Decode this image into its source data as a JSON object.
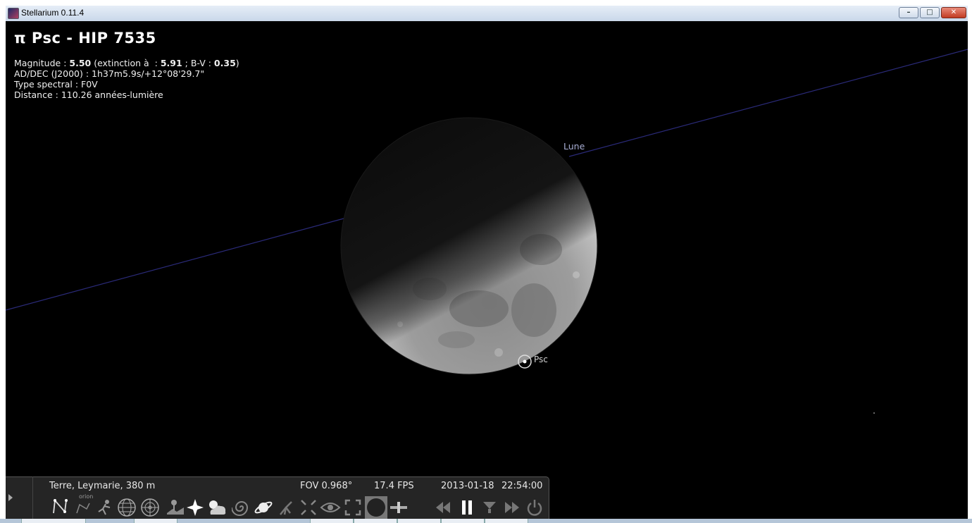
{
  "window": {
    "title": "Stellarium 0.11.4",
    "controls": {
      "minimize": "–",
      "maximize": "□",
      "close": "✕"
    }
  },
  "info": {
    "title": "π Psc - HIP 7535",
    "magnitude_label": "Magnitude : ",
    "magnitude_value": "5.50",
    "extinction_label": " (extinction à  : ",
    "extinction_value": "5.91",
    "bv_label": " ; B-V : ",
    "bv_value": "0.35",
    "bv_close": ")",
    "radec": "AD/DEC (J2000) : 1h37m5.9s/+12°08'29.7\"",
    "spectral": "Type spectral : F0V",
    "distance": "Distance : 110.26 années-lumière"
  },
  "sky": {
    "labels": {
      "moon": "Lune",
      "star": "Psc"
    },
    "colors": {
      "ecliptic": "#2a2a78",
      "moon_lit": "#a8a8a8",
      "moon_dark": "#161616"
    }
  },
  "status": {
    "location": "Terre, Leymarie, 380 m",
    "fov": "FOV 0.968°",
    "fps": "17.4 FPS",
    "date": "2013-01-18",
    "time": "22:54:00"
  },
  "toolbar": {
    "orion_caption": "orion",
    "buttons": [
      "constellation-lines",
      "constellation-labels",
      "constellation-art",
      "equatorial-grid",
      "azimuthal-grid",
      "ground",
      "cardinal-points",
      "atmosphere",
      "nebulae",
      "planet-labels",
      "equatorial-mount",
      "center-on-selected",
      "night-mode",
      "full-screen",
      "ocular",
      "satellites",
      "decrease-time-speed",
      "pause-time",
      "real-time",
      "increase-time-speed",
      "quit"
    ]
  }
}
